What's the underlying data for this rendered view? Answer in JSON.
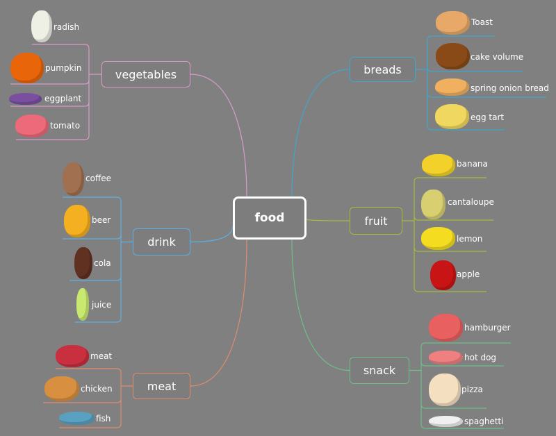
{
  "center": {
    "label": "food",
    "color": "#3fbcc6"
  },
  "branches": [
    {
      "id": "vegetables",
      "label": "vegetables",
      "color": "#d99bc9",
      "items": [
        {
          "label": "radish",
          "icon": "radish-icon",
          "color": "#eef0e6"
        },
        {
          "label": "pumpkin",
          "icon": "pumpkin-icon",
          "color": "#e8650a"
        },
        {
          "label": "eggplant",
          "icon": "eggplant-icon",
          "color": "#7a4fa0"
        },
        {
          "label": "tomato",
          "icon": "tomato-icon",
          "color": "#ec6a7a"
        }
      ]
    },
    {
      "id": "breads",
      "label": "breads",
      "color": "#3fa6cc",
      "items": [
        {
          "label": "Toast",
          "icon": "toast-icon",
          "color": "#e8a868"
        },
        {
          "label": "cake volume",
          "icon": "cake-roll-icon",
          "color": "#8a4a18"
        },
        {
          "label": "spring onion bread",
          "icon": "spring-onion-bread-icon",
          "color": "#f0b060"
        },
        {
          "label": "egg tart",
          "icon": "egg-tart-icon",
          "color": "#f0d860"
        }
      ]
    },
    {
      "id": "fruit",
      "label": "fruit",
      "color": "#a4bc3c",
      "items": [
        {
          "label": "banana",
          "icon": "banana-icon",
          "color": "#f2d22a"
        },
        {
          "label": "cantaloupe",
          "icon": "cantaloupe-icon",
          "color": "#d8d070"
        },
        {
          "label": "lemon",
          "icon": "lemon-icon",
          "color": "#f4dc20"
        },
        {
          "label": "apple",
          "icon": "apple-icon",
          "color": "#c81414"
        }
      ]
    },
    {
      "id": "snack",
      "label": "snack",
      "color": "#6cc088",
      "items": [
        {
          "label": "hamburger",
          "icon": "hamburger-icon",
          "color": "#e86060"
        },
        {
          "label": "hot dog",
          "icon": "hot-dog-icon",
          "color": "#f08080"
        },
        {
          "label": "pizza",
          "icon": "pizza-icon",
          "color": "#f4e0c0"
        },
        {
          "label": "spaghetti",
          "icon": "spaghetti-icon",
          "color": "#f0f0f0"
        }
      ]
    },
    {
      "id": "meat",
      "label": "meat",
      "color": "#e08c6c",
      "items": [
        {
          "label": "meat",
          "icon": "steak-icon",
          "color": "#c83040"
        },
        {
          "label": "chicken",
          "icon": "chicken-icon",
          "color": "#d89040"
        },
        {
          "label": "fish",
          "icon": "fish-icon",
          "color": "#5aa0c0"
        }
      ]
    },
    {
      "id": "drink",
      "label": "drink",
      "color": "#5cb0e6",
      "items": [
        {
          "label": "coffee",
          "icon": "coffee-icon",
          "color": "#a07050"
        },
        {
          "label": "beer",
          "icon": "beer-icon",
          "color": "#f4b020"
        },
        {
          "label": "cola",
          "icon": "cola-icon",
          "color": "#603020"
        },
        {
          "label": "juice",
          "icon": "juice-icon",
          "color": "#c8e870"
        }
      ]
    }
  ]
}
